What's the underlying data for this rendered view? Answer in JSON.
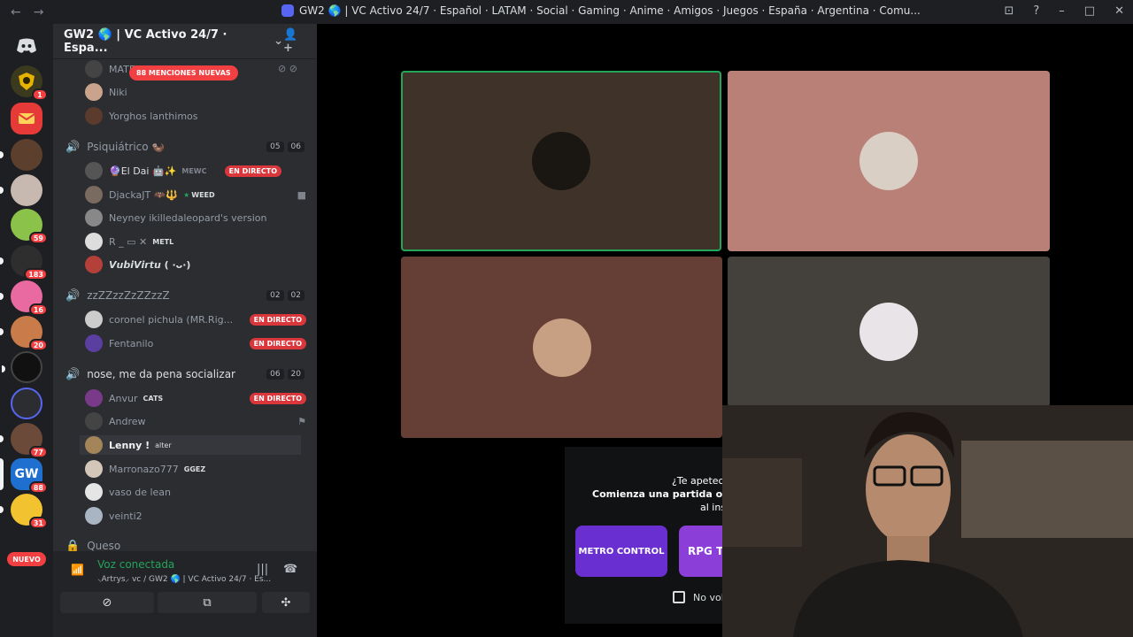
{
  "window": {
    "title": "GW2 🌎 | VC Activo 24/7 · Español · LATAM · Social · Gaming · Anime · Amigos · Juegos · España · Argentina · Comu..."
  },
  "servers": {
    "badges": [
      "1",
      "59",
      "183",
      "16",
      "20",
      "77",
      "88",
      "31"
    ],
    "nuevo_label": "NUEVO"
  },
  "server": {
    "name": "GW2 🌎 | VC Activo 24/7 · Espa..."
  },
  "mention_pill": "88 MENCIONES NUEVAS",
  "top_users": [
    "MATE",
    "Niki",
    "Yorghos lanthimos"
  ],
  "channels": [
    {
      "name": "Psiquiátrico 🦦",
      "count_a": "05",
      "count_b": "06"
    },
    {
      "name": "zzZZzzZzZZzzZ",
      "count_a": "02",
      "count_b": "02"
    },
    {
      "name": "nose, me da pena socializar",
      "count_a": "06",
      "count_b": "20"
    },
    {
      "name": "Queso"
    }
  ],
  "psiq_users": [
    {
      "name": "🔮El Dai 🤖✨",
      "tag": "MEWC",
      "live": "EN DIRECTO"
    },
    {
      "name": "DjackaJT 🦇🔱",
      "tag": "WEED"
    },
    {
      "name": "Neyney ikilledaleopard's version"
    },
    {
      "name": "R _ ▭ ✕",
      "tag": "METL"
    },
    {
      "name": "𝙑𝙪𝙗𝙞𝙑𝙞𝙧𝙩𝙪 ( ·ᴗ·)"
    }
  ],
  "zz_users": [
    {
      "name": "coronel pichula (MR.Rig...",
      "live": "EN DIRECTO"
    },
    {
      "name": "Fentanilo",
      "live": "EN DIRECTO"
    }
  ],
  "nose_users": [
    {
      "name": "Anvur",
      "tag": "CATS",
      "live": "EN DIRECTO"
    },
    {
      "name": "Andrew"
    },
    {
      "name": "Lenny !",
      "tag": "alter"
    },
    {
      "name": "Marronazo777",
      "tag": "GGEZ"
    },
    {
      "name": "vaso de lean"
    },
    {
      "name": "veinti2"
    }
  ],
  "voice": {
    "status": "Voz conectada",
    "channel": "⸜Artrys⸝ vc / GW2 🌎 | VC Activo 24/7 · Es..."
  },
  "activity": {
    "line1": "¿Te apetece",
    "line2": "Comienza una partida o una li",
    "line3": "al ins",
    "card1": "METRO CONTROL",
    "card2": "RPG Ta",
    "checkbox_label": "No volv"
  },
  "colors": {
    "accent": "#5865f2",
    "live": "#da373c",
    "voice_green": "#23a55a",
    "tile1": "#3f3329",
    "tile2": "#b88077",
    "tile3": "#653e36",
    "tile4": "#44403c"
  }
}
